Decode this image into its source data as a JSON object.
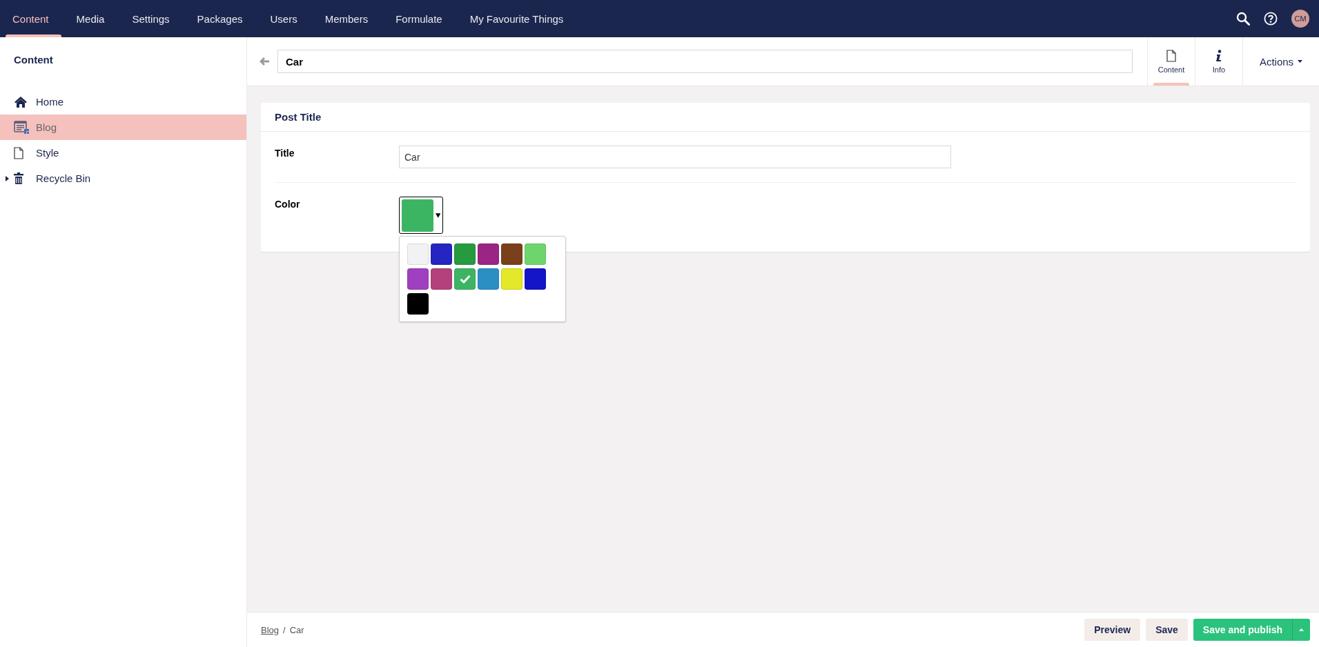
{
  "top_nav": {
    "sections": [
      {
        "label": "Content",
        "selected": true
      },
      {
        "label": "Media",
        "selected": false
      },
      {
        "label": "Settings",
        "selected": false
      },
      {
        "label": "Packages",
        "selected": false
      },
      {
        "label": "Users",
        "selected": false
      },
      {
        "label": "Members",
        "selected": false
      },
      {
        "label": "Formulate",
        "selected": false
      },
      {
        "label": "My Favourite Things",
        "selected": false
      }
    ],
    "avatar": "CM"
  },
  "sidebar": {
    "title": "Content",
    "items": [
      {
        "label": "Home",
        "kind": "home",
        "selected": false,
        "expander": false
      },
      {
        "label": "Blog",
        "kind": "blog",
        "selected": true,
        "expander": false
      },
      {
        "label": "Style",
        "kind": "document",
        "selected": false,
        "expander": false
      },
      {
        "label": "Recycle Bin",
        "kind": "trash",
        "selected": false,
        "expander": true
      }
    ]
  },
  "header": {
    "name": "Car",
    "apps": [
      {
        "label": "Content",
        "kind": "document",
        "selected": true
      },
      {
        "label": "Info",
        "kind": "info",
        "selected": false
      }
    ],
    "actions": "Actions"
  },
  "group": {
    "title": "Post Title",
    "properties": [
      {
        "label": "Title",
        "kind": "text",
        "value": "Car"
      },
      {
        "label": "Color",
        "kind": "color",
        "open": true,
        "swatches": [
          {
            "color": "#f2f2f4",
            "selected": false
          },
          {
            "color": "#2525c2",
            "selected": false
          },
          {
            "color": "#259a3f",
            "selected": false
          },
          {
            "color": "#9b2584",
            "selected": false
          },
          {
            "color": "#7a401c",
            "selected": false
          },
          {
            "color": "#6ed56d",
            "selected": false
          },
          {
            "color": "#a03fc0",
            "selected": false
          },
          {
            "color": "#b4417c",
            "selected": false
          },
          {
            "color": "#3cb563",
            "selected": true
          },
          {
            "color": "#2b8fc4",
            "selected": false
          },
          {
            "color": "#e3e82a",
            "selected": false
          },
          {
            "color": "#1414c8",
            "selected": false
          },
          {
            "color": "#000000",
            "selected": false
          }
        ]
      }
    ]
  },
  "footer": {
    "breadcrumb": [
      "Blog",
      "Car"
    ],
    "separator": "/",
    "buttons": [
      {
        "label": "Preview",
        "kind": "secondary"
      },
      {
        "label": "Save",
        "kind": "secondary"
      },
      {
        "label": "Save and publish",
        "kind": "primary"
      }
    ]
  }
}
